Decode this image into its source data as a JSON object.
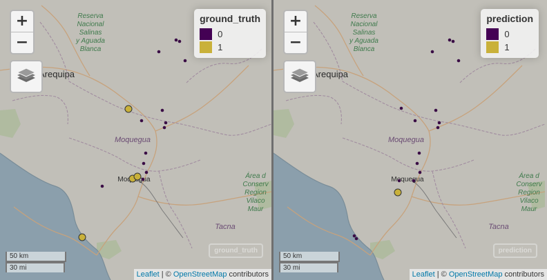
{
  "controls": {
    "zoom_in": "+",
    "zoom_out": "−"
  },
  "place_names": {
    "reserva": [
      "Reserva",
      "Nacional",
      "Salinas",
      "y Aguada",
      "Blanca"
    ],
    "arequipa": "Arequipa",
    "moquegua_region": "Moquegua",
    "moquegua_city": "Moquegua",
    "tacna": "Tacna",
    "area_conservacion": [
      "Área d",
      "Conserv",
      "Region",
      "Vilaco",
      "Maur"
    ]
  },
  "panels": [
    {
      "legend_title": "ground_truth",
      "legend": [
        {
          "label": "0",
          "color": "#440154"
        },
        {
          "label": "1",
          "color": "#c9b13a"
        }
      ],
      "layer_label": "ground_truth"
    },
    {
      "legend_title": "prediction",
      "legend": [
        {
          "label": "0",
          "color": "#440154"
        },
        {
          "label": "1",
          "color": "#c9b13a"
        }
      ],
      "layer_label": "prediction"
    }
  ],
  "scale": {
    "km": "50 km",
    "mi": "30 mi"
  },
  "attribution": {
    "leaflet": "Leaflet",
    "sep": " | © ",
    "osm": "OpenStreetMap",
    "tail": " contributors"
  },
  "colors": {
    "class_0": "#3a0d45",
    "class_1": "#c9b13a"
  }
}
